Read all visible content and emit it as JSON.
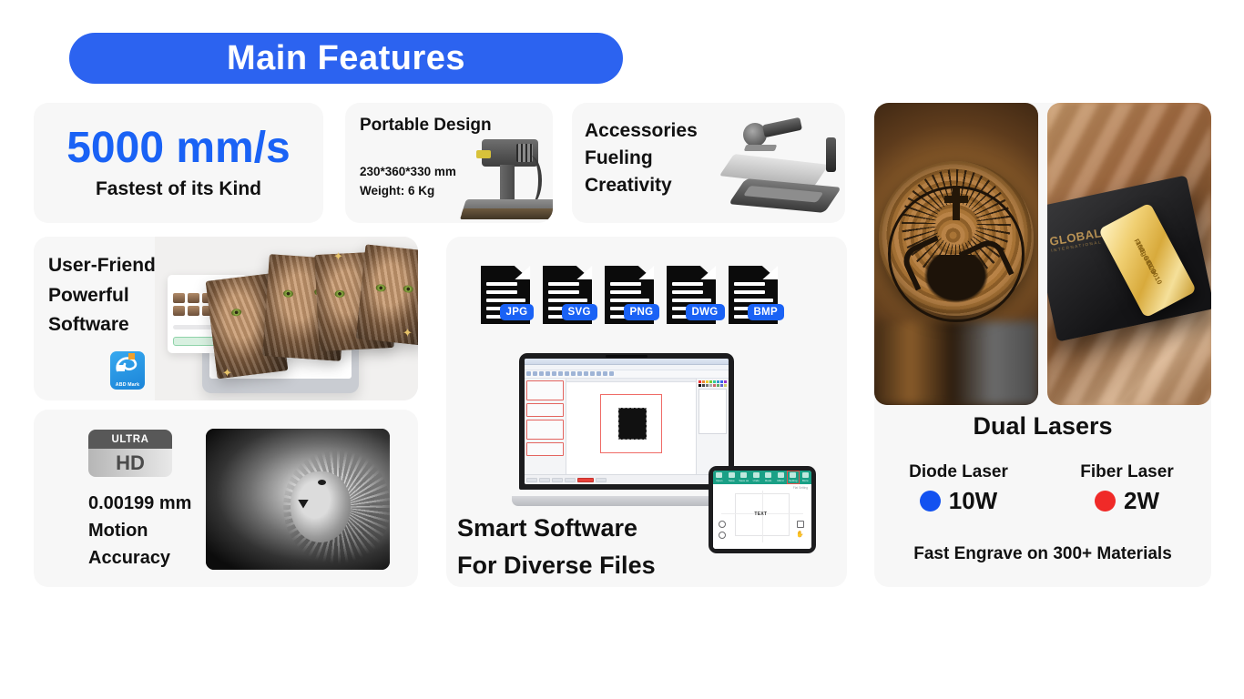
{
  "header": {
    "title": "Main Features",
    "accent": "#2c63f0"
  },
  "speed_card": {
    "value": "5000 mm/s",
    "subtitle": "Fastest of its Kind",
    "value_color": "#1a62f5"
  },
  "portable_card": {
    "title": "Portable Design",
    "dimensions": "230*360*330 mm",
    "weight": "Weight: 6 Kg",
    "image_name": "portable-laser-engraver-photo"
  },
  "accessories_card": {
    "title": "Accessories\nFueling\nCreativity",
    "line1": "Accessories",
    "line2": "Fueling",
    "line3": "Creativity",
    "image_name": "laser-accessories-photo"
  },
  "software_card": {
    "line1": "User-Friendly",
    "line2": "Powerful",
    "line3": "Software",
    "app_icon_label": "ABD Mark",
    "image_name": "laptop-with-cat-photos"
  },
  "files_card": {
    "file_types": [
      "JPG",
      "SVG",
      "PNG",
      "DWG",
      "BMP"
    ],
    "badge_color": "#1a62f5",
    "smart_line1": "Smart Software",
    "smart_line2": "For Diverse Files",
    "tablet_text_object": "TEXT",
    "tablet_toolbar": [
      "Open",
      "Save",
      "Save as",
      "Undo",
      "Redo",
      "Mirror",
      "Setting",
      "More"
    ],
    "tablet_hint": "Flat Setting"
  },
  "accuracy_card": {
    "badge_top": "ULTRA",
    "badge_bottom": "HD",
    "value": "0.00199 mm",
    "line2": "Motion",
    "line3": "Accuracy",
    "image_name": "engraved-lion-portrait"
  },
  "lasers_card": {
    "title": "Dual Lasers",
    "materials": "Fast Engrave on 300+ Materials",
    "lasers": [
      {
        "name": "Diode Laser",
        "power": "10W",
        "dot_color": "#1352f0"
      },
      {
        "name": "Fiber Laser",
        "power": "2W",
        "dot_color": "#f02a28"
      }
    ],
    "photos": [
      {
        "name": "engraved-wood-slice-deer-cross",
        "caption": ""
      },
      {
        "name": "engraved-gold-bar-on-box",
        "gold_text_1": "100g",
        "gold_text_2": "FINE GOLD",
        "gold_text_3": "999.9",
        "gold_text_4": "G00010",
        "box_logo": "GLOBAL",
        "box_logo_sub": "INTERNATIONAL"
      }
    ]
  }
}
